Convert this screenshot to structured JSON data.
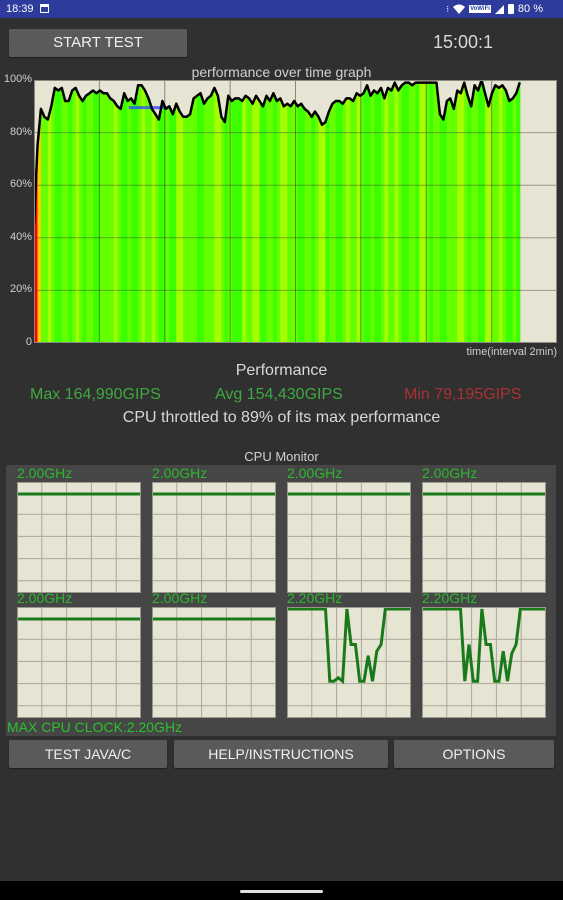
{
  "status_bar": {
    "time": "18:39",
    "vowifi_label": "VoWiFi",
    "battery": "80 %"
  },
  "toolbar": {
    "start_label": "START TEST",
    "timer": "15:00:1"
  },
  "chart_data": {
    "type": "area",
    "title": "performance over time graph",
    "xlabel": "time(interval 2min)",
    "ylabel": "",
    "yticks": [
      "100%",
      "80%",
      "60%",
      "40%",
      "20%",
      "0"
    ],
    "ylim": [
      0,
      100
    ],
    "x_intervals": 8,
    "x_unit": "2min interval",
    "x_data_extent_intervals": 7.43,
    "grid": true,
    "fill_colors": [
      "#3cff00",
      "#66ff00",
      "#a6ff00",
      "#ff0000",
      "#ffcc00"
    ],
    "line_color": "#000000",
    "series": [
      {
        "name": "performance",
        "values": [
          45,
          75,
          89,
          86,
          85,
          90,
          97,
          96,
          97,
          92,
          92,
          96,
          97,
          94,
          92,
          94,
          95,
          96,
          95,
          96,
          95,
          95,
          93,
          92,
          90,
          89,
          95,
          92,
          93,
          91,
          98,
          98,
          96,
          93,
          89,
          87,
          85,
          92,
          89,
          90,
          87,
          91,
          88,
          86,
          86,
          87,
          93,
          94,
          95,
          91,
          93,
          94,
          97,
          94,
          86,
          84,
          94,
          92,
          93,
          93,
          92,
          94,
          93,
          91,
          94,
          92,
          90,
          94,
          92,
          95,
          92,
          93,
          90,
          91,
          90,
          92,
          90,
          91,
          89,
          88,
          86,
          88,
          86,
          83,
          84,
          88,
          91,
          92,
          92,
          91,
          93,
          93,
          92,
          95,
          94,
          95,
          98,
          94,
          96,
          95,
          97,
          93,
          97,
          96,
          99,
          96,
          98,
          99,
          99,
          98,
          99,
          99,
          99,
          99,
          99,
          99,
          99,
          87,
          85,
          92,
          93,
          89,
          96,
          95,
          99,
          94,
          90,
          98,
          96,
          100,
          95,
          90,
          95,
          98,
          97,
          98,
          96,
          92,
          93,
          95,
          99
        ]
      },
      {
        "name": "reference-band",
        "values": [
          89.5
        ],
        "range_intervals": [
          1.45,
          2.0
        ],
        "color": "#3050ff"
      }
    ]
  },
  "performance": {
    "title": "Performance",
    "max": "Max 164,990GIPS",
    "avg": "Avg 154,430GIPS",
    "min": "Min 79,195GIPS",
    "max_color": "#3fa83f",
    "avg_color": "#3fa83f",
    "min_color": "#a83232",
    "throttle": "CPU throttled to 89% of its max performance"
  },
  "cpu_monitor": {
    "title": "CPU Monitor",
    "max_clock": "MAX CPU CLOCK:2.20GHz",
    "line_color": "#1a7a1a",
    "cores": [
      {
        "freq": "2.00GHz",
        "values": [
          0.91,
          0.91,
          0.91,
          0.91,
          0.91,
          0.91,
          0.91,
          0.91,
          0.91,
          0.91,
          0.91,
          0.91,
          0.91,
          0.91,
          0.91,
          0.91,
          0.91,
          0.91,
          0.91,
          0.91,
          0.91,
          0.91,
          0.91,
          0.91,
          0.91
        ]
      },
      {
        "freq": "2.00GHz",
        "values": [
          0.91,
          0.91,
          0.91,
          0.91,
          0.91,
          0.91,
          0.91,
          0.91,
          0.91,
          0.91,
          0.91,
          0.91,
          0.91,
          0.91,
          0.91,
          0.91,
          0.91,
          0.91,
          0.91,
          0.91,
          0.91,
          0.91,
          0.91,
          0.91,
          0.91
        ]
      },
      {
        "freq": "2.00GHz",
        "values": [
          0.91,
          0.91,
          0.91,
          0.91,
          0.91,
          0.91,
          0.91,
          0.91,
          0.91,
          0.91,
          0.91,
          0.91,
          0.91,
          0.91,
          0.91,
          0.91,
          0.91,
          0.91,
          0.91,
          0.91,
          0.91,
          0.91,
          0.91,
          0.91,
          0.91
        ]
      },
      {
        "freq": "2.00GHz",
        "values": [
          0.91,
          0.91,
          0.91,
          0.91,
          0.91,
          0.91,
          0.91,
          0.91,
          0.91,
          0.91,
          0.91,
          0.91,
          0.91,
          0.91,
          0.91,
          0.91,
          0.91,
          0.91,
          0.91,
          0.91,
          0.91,
          0.91,
          0.91,
          0.91,
          0.91
        ]
      },
      {
        "freq": "2.00GHz",
        "values": [
          0.91,
          0.91,
          0.91,
          0.91,
          0.91,
          0.91,
          0.91,
          0.91,
          0.91,
          0.91,
          0.91,
          0.91,
          0.91,
          0.91,
          0.91,
          0.91,
          0.91,
          0.91,
          0.91,
          0.91,
          0.91,
          0.91,
          0.91,
          0.91,
          0.91
        ]
      },
      {
        "freq": "2.00GHz",
        "values": [
          0.91,
          0.91,
          0.91,
          0.91,
          0.91,
          0.91,
          0.91,
          0.91,
          0.91,
          0.91,
          0.91,
          0.91,
          0.91,
          0.91,
          0.91,
          0.91,
          0.91,
          0.91,
          0.91,
          0.91,
          0.91,
          0.91,
          0.91,
          0.91,
          0.91
        ]
      },
      {
        "freq": "2.20GHz",
        "values": [
          1,
          1,
          1,
          1,
          1,
          1,
          1,
          1,
          1,
          1,
          0.35,
          0.35,
          0.38,
          0.35,
          1,
          0.68,
          0.68,
          0.35,
          0.35,
          0.58,
          0.35,
          0.62,
          0.68,
          1,
          1,
          1,
          1,
          1,
          1,
          1
        ]
      },
      {
        "freq": "2.20GHz",
        "values": [
          1,
          1,
          1,
          1,
          1,
          1,
          1,
          1,
          1,
          1,
          0.35,
          0.68,
          0.35,
          0.35,
          1,
          0.68,
          0.68,
          0.35,
          0.35,
          0.62,
          0.35,
          0.6,
          0.68,
          1,
          1,
          1,
          1,
          1,
          1,
          1
        ]
      }
    ]
  },
  "buttons": {
    "java": "TEST JAVA/C",
    "help": "HELP/INSTRUCTIONS",
    "options": "OPTIONS"
  }
}
